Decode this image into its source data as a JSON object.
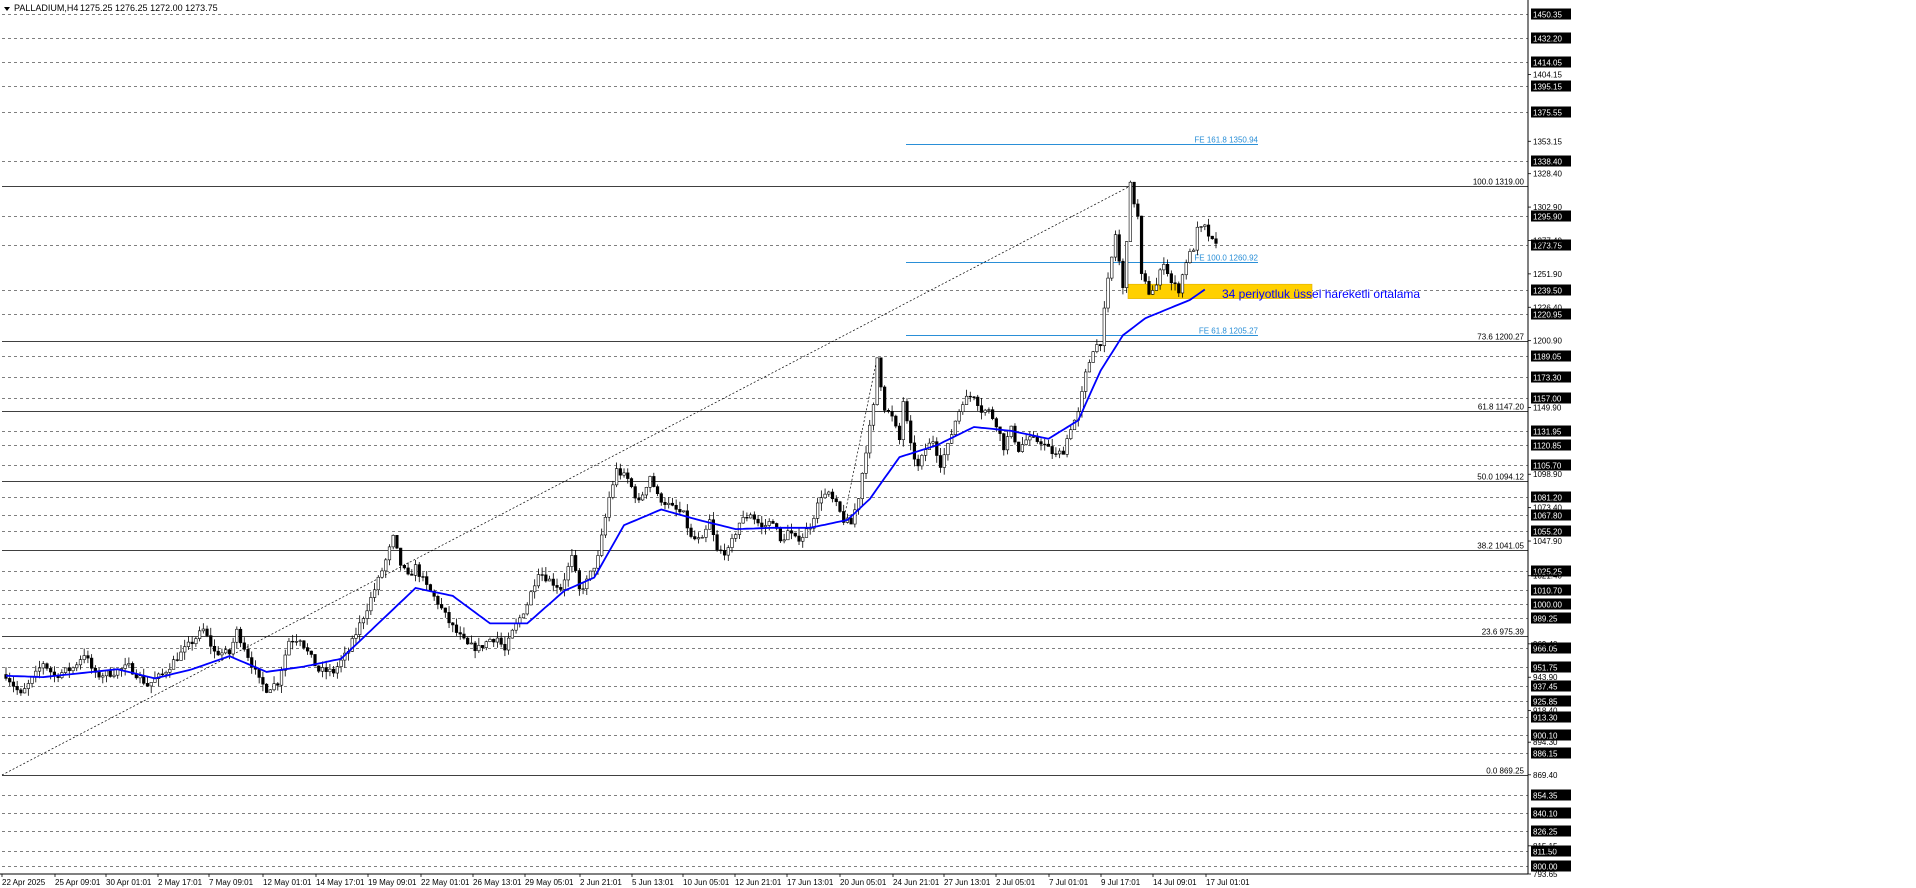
{
  "header": {
    "title": "PALLADIUM,H4",
    "quote": "1275.25 1276.25 1272.00 1273.75"
  },
  "chart_data": {
    "type": "candlestick",
    "symbol": "PALLADIUM",
    "timeframe": "H4",
    "ylim": [
      793.65,
      1459.5
    ],
    "x_ticks": [
      "22 Apr 2025",
      "25 Apr 09:01",
      "30 Apr 01:01",
      "2 May 17:01",
      "7 May 09:01",
      "12 May 01:01",
      "14 May 17:01",
      "19 May 09:01",
      "22 May 01:01",
      "26 May 13:01",
      "29 May 05:01",
      "2 Jun 21:01",
      "5 Jun 13:01",
      "10 Jun 05:01",
      "12 Jun 21:01",
      "17 Jun 13:01",
      "20 Jun 05:01",
      "24 Jun 21:01",
      "27 Jun 13:01",
      "2 Jul 05:01",
      "7 Jul 01:01",
      "9 Jul 17:01",
      "14 Jul 09:01",
      "17 Jul 01:01"
    ],
    "y_ticks_plain": [
      "1404.15",
      "1353.15",
      "1328.40",
      "1302.90",
      "1277.40",
      "1251.90",
      "1226.40",
      "1200.90",
      "1149.90",
      "1098.90",
      "1073.40",
      "1047.90",
      "1021.40",
      "969.40",
      "943.90",
      "918.40",
      "894.30",
      "869.40",
      "815.15",
      "793.65"
    ],
    "level_labels": [
      "1450.35",
      "1432.20",
      "1414.05",
      "1395.15",
      "1375.55",
      "1338.40",
      "1295.90",
      "1273.75",
      "1239.50",
      "1220.95",
      "1189.05",
      "1173.30",
      "1157.00",
      "1131.95",
      "1120.85",
      "1105.70",
      "1081.20",
      "1067.80",
      "1055.20",
      "1025.25",
      "1010.70",
      "1000.00",
      "989.25",
      "966.05",
      "951.75",
      "937.45",
      "925.85",
      "913.30",
      "900.10",
      "886.15",
      "854.35",
      "840.10",
      "826.25",
      "811.50",
      "800.00"
    ],
    "fib_retracement": [
      {
        "label": "100.0 1319.00",
        "value": 1319.0
      },
      {
        "label": "73.6 1200.27",
        "value": 1200.27
      },
      {
        "label": "61.8 1147.20",
        "value": 1147.2
      },
      {
        "label": "50.0 1094.12",
        "value": 1094.12
      },
      {
        "label": "38.2 1041.05",
        "value": 1041.05
      },
      {
        "label": "23.6 975.39",
        "value": 975.39
      },
      {
        "label": "0.0 869.25",
        "value": 869.25
      }
    ],
    "fib_expansion": [
      {
        "label": "FE 161.8 1350.94",
        "value": 1350.94
      },
      {
        "label": "FE 100.0 1260.92",
        "value": 1260.92
      },
      {
        "label": "FE 61.8 1205.27",
        "value": 1205.27
      }
    ],
    "support_zone": [
      1233,
      1244
    ],
    "annotation": "34 periyotluk üssel hareketli ortalama",
    "price_path": [
      [
        0,
        946
      ],
      [
        4,
        930
      ],
      [
        8,
        946
      ],
      [
        10,
        955
      ],
      [
        13,
        945
      ],
      [
        18,
        951
      ],
      [
        21,
        962
      ],
      [
        24,
        945
      ],
      [
        28,
        947
      ],
      [
        33,
        952
      ],
      [
        38,
        938
      ],
      [
        42,
        946
      ],
      [
        45,
        956
      ],
      [
        48,
        965
      ],
      [
        53,
        980
      ],
      [
        56,
        963
      ],
      [
        60,
        962
      ],
      [
        62,
        979
      ],
      [
        64,
        967
      ],
      [
        68,
        941
      ],
      [
        70,
        935
      ],
      [
        73,
        940
      ],
      [
        76,
        972
      ],
      [
        79,
        974
      ],
      [
        81,
        963
      ],
      [
        84,
        949
      ],
      [
        88,
        948
      ],
      [
        92,
        964
      ],
      [
        95,
        984
      ],
      [
        97,
        997
      ],
      [
        100,
        1018
      ],
      [
        102,
        1033
      ],
      [
        104,
        1050
      ],
      [
        106,
        1030
      ],
      [
        108,
        1020
      ],
      [
        110,
        1028
      ],
      [
        113,
        1013
      ],
      [
        116,
        1001
      ],
      [
        119,
        986
      ],
      [
        121,
        978
      ],
      [
        124,
        968
      ],
      [
        127,
        966
      ],
      [
        130,
        973
      ],
      [
        132,
        974
      ],
      [
        134,
        964
      ],
      [
        136,
        978
      ],
      [
        140,
        1000
      ],
      [
        143,
        1025
      ],
      [
        146,
        1018
      ],
      [
        149,
        1012
      ],
      [
        152,
        1035
      ],
      [
        154,
        1010
      ],
      [
        156,
        1017
      ],
      [
        159,
        1035
      ],
      [
        162,
        1081
      ],
      [
        164,
        1102
      ],
      [
        167,
        1095
      ],
      [
        170,
        1077
      ],
      [
        173,
        1098
      ],
      [
        175,
        1082
      ],
      [
        179,
        1073
      ],
      [
        182,
        1068
      ],
      [
        184,
        1050
      ],
      [
        187,
        1048
      ],
      [
        189,
        1063
      ],
      [
        191,
        1040
      ],
      [
        194,
        1040
      ],
      [
        197,
        1062
      ],
      [
        200,
        1069
      ],
      [
        203,
        1058
      ],
      [
        206,
        1064
      ],
      [
        208,
        1047
      ],
      [
        210,
        1055
      ],
      [
        212,
        1049
      ],
      [
        214,
        1052
      ],
      [
        216,
        1060
      ],
      [
        219,
        1083
      ],
      [
        221,
        1083
      ],
      [
        223,
        1075
      ],
      [
        225,
        1064
      ],
      [
        227,
        1061
      ],
      [
        229,
        1082
      ],
      [
        231,
        1118
      ],
      [
        233,
        1150
      ],
      [
        234,
        1188
      ],
      [
        235,
        1168
      ],
      [
        236,
        1150
      ],
      [
        238,
        1142
      ],
      [
        240,
        1125
      ],
      [
        241,
        1155
      ],
      [
        243,
        1120
      ],
      [
        245,
        1104
      ],
      [
        247,
        1118
      ],
      [
        249,
        1125
      ],
      [
        251,
        1107
      ],
      [
        253,
        1120
      ],
      [
        255,
        1140
      ],
      [
        257,
        1155
      ],
      [
        260,
        1160
      ],
      [
        262,
        1148
      ],
      [
        264,
        1147
      ],
      [
        266,
        1138
      ],
      [
        268,
        1120
      ],
      [
        270,
        1133
      ],
      [
        272,
        1118
      ],
      [
        274,
        1125
      ],
      [
        276,
        1125
      ],
      [
        278,
        1124
      ],
      [
        280,
        1118
      ],
      [
        282,
        1113
      ],
      [
        284,
        1117
      ],
      [
        286,
        1135
      ],
      [
        288,
        1145
      ],
      [
        290,
        1175
      ],
      [
        292,
        1195
      ],
      [
        294,
        1200
      ],
      [
        296,
        1246
      ],
      [
        298,
        1282
      ],
      [
        300,
        1240
      ],
      [
        302,
        1319
      ],
      [
        304,
        1295
      ],
      [
        305,
        1250
      ],
      [
        307,
        1238
      ],
      [
        309,
        1243
      ],
      [
        311,
        1262
      ],
      [
        313,
        1245
      ],
      [
        315,
        1240
      ],
      [
        317,
        1262
      ],
      [
        319,
        1272
      ],
      [
        320,
        1285
      ],
      [
        322,
        1287
      ],
      [
        324,
        1276
      ],
      [
        325,
        1273
      ]
    ],
    "ema34_path": [
      [
        0,
        945
      ],
      [
        10,
        944
      ],
      [
        20,
        947
      ],
      [
        30,
        950
      ],
      [
        40,
        943
      ],
      [
        50,
        950
      ],
      [
        60,
        960
      ],
      [
        70,
        948
      ],
      [
        80,
        952
      ],
      [
        90,
        958
      ],
      [
        100,
        985
      ],
      [
        110,
        1012
      ],
      [
        120,
        1006
      ],
      [
        130,
        985
      ],
      [
        140,
        985
      ],
      [
        150,
        1010
      ],
      [
        158,
        1020
      ],
      [
        166,
        1060
      ],
      [
        176,
        1072
      ],
      [
        186,
        1064
      ],
      [
        196,
        1057
      ],
      [
        206,
        1058
      ],
      [
        216,
        1058
      ],
      [
        226,
        1064
      ],
      [
        232,
        1080
      ],
      [
        240,
        1112
      ],
      [
        250,
        1121
      ],
      [
        260,
        1135
      ],
      [
        270,
        1132
      ],
      [
        280,
        1126
      ],
      [
        288,
        1140
      ],
      [
        294,
        1178
      ],
      [
        300,
        1205
      ],
      [
        306,
        1218
      ],
      [
        312,
        1225
      ],
      [
        318,
        1232
      ],
      [
        322,
        1240
      ]
    ]
  },
  "colors": {
    "background": "#ffffff",
    "candle": "#000000",
    "ema": "#0000ff",
    "fe": "#2a8fd7",
    "zone": "#ffd000",
    "axis": "#000000"
  }
}
